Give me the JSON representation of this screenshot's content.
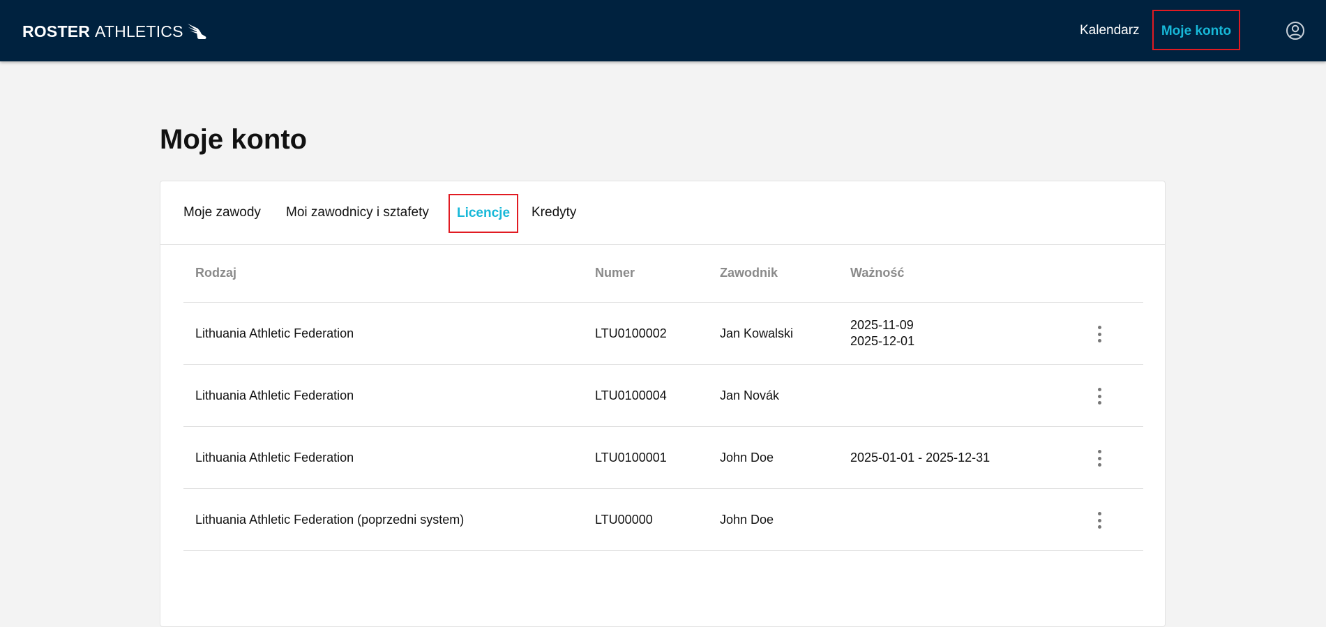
{
  "header": {
    "logo_bold": "ROSTER",
    "logo_light": "ATHLETICS",
    "logo_icon": "winged-shoe-icon",
    "nav": {
      "calendar": "Kalendarz",
      "account": "Moje konto"
    },
    "avatar_icon": "user-circle-icon"
  },
  "page": {
    "title": "Moje konto"
  },
  "tabs": [
    {
      "label": "Moje zawody",
      "active": false
    },
    {
      "label": "Moi zawodnicy i sztafety",
      "active": false
    },
    {
      "label": "Licencje",
      "active": true
    },
    {
      "label": "Kredyty",
      "active": false
    }
  ],
  "table": {
    "columns": [
      "Rodzaj",
      "Numer",
      "Zawodnik",
      "Ważność"
    ],
    "rows": [
      {
        "type": "Lithuania Athletic Federation",
        "number": "LTU0100002",
        "athlete": "Jan Kowalski",
        "validity_line1": "2025-11-09",
        "validity_line2": "2025-12-01"
      },
      {
        "type": "Lithuania Athletic Federation",
        "number": "LTU0100004",
        "athlete": "Jan Novák",
        "validity_line1": "",
        "validity_line2": ""
      },
      {
        "type": "Lithuania Athletic Federation",
        "number": "LTU0100001",
        "athlete": "John Doe",
        "validity_line1": "2025-01-01 - 2025-12-31",
        "validity_line2": ""
      },
      {
        "type": "Lithuania Athletic Federation (poprzedni system)",
        "number": "LTU00000",
        "athlete": "John Doe",
        "validity_line1": "",
        "validity_line2": ""
      }
    ],
    "row_menu_icon": "more-vertical-icon"
  },
  "colors": {
    "header_bg": "#00223f",
    "accent": "#17b8d8",
    "highlight_border": "#e11b22",
    "page_bg": "#f3f3f3"
  }
}
